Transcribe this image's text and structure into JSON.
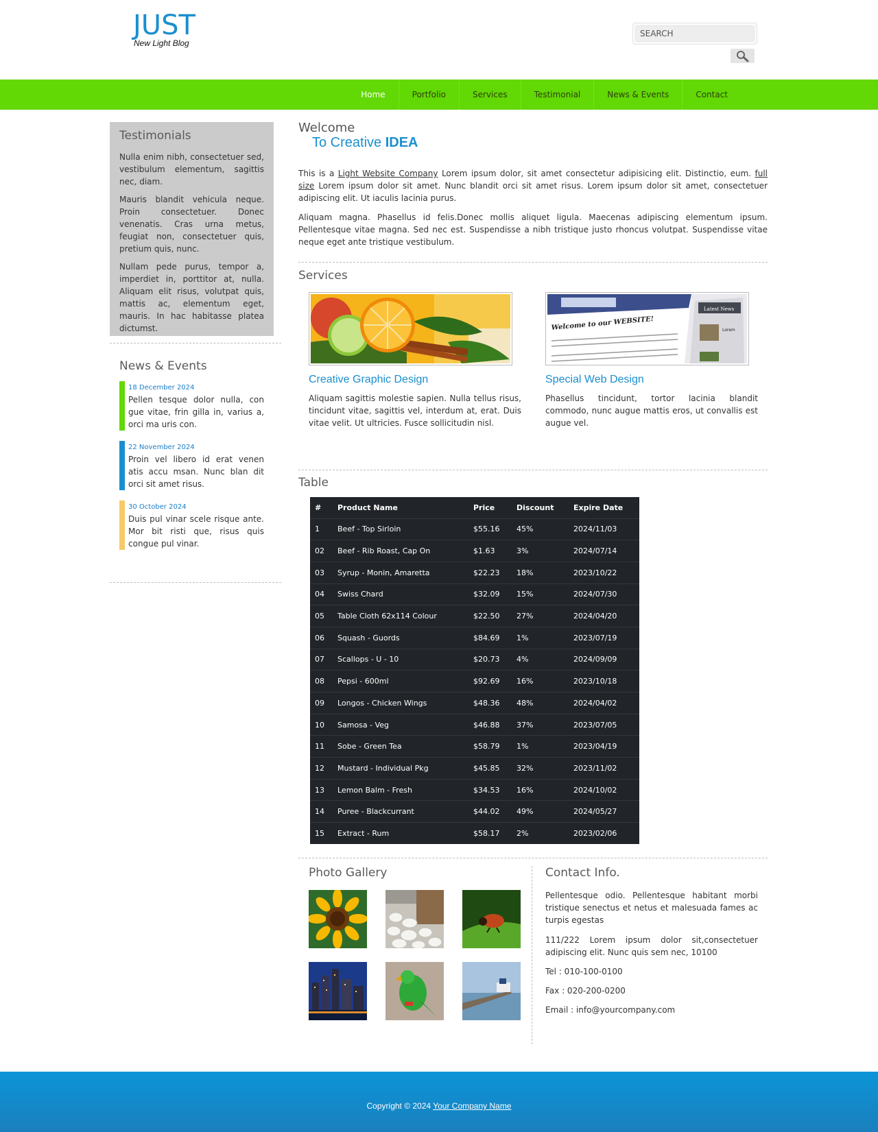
{
  "header": {
    "logo_title": "JUST",
    "logo_tagline": "New Light Blog",
    "search_placeholder": "SEARCH"
  },
  "nav": {
    "items": [
      "Home",
      "Portfolio",
      "Services",
      "Testimonial",
      "News & Events",
      "Contact"
    ],
    "active": "Home",
    "color": "#62d804"
  },
  "sidebar": {
    "testimonials": {
      "heading": "Testimonials",
      "paragraphs": [
        "Nulla enim nibh, consectetuer sed, vestibulum elementum, sagittis nec, diam.",
        "Mauris blandit vehicula neque. Proin consectetuer. Donec venenatis. Cras urna metus, feugiat non, consectetuer quis, pretium quis, nunc.",
        "Nullam pede purus, tempor a, imperdiet in, porttitor at, nulla. Aliquam elit risus, volutpat quis, mattis ac, elementum eget, mauris. In hac habitasse platea dictumst."
      ]
    },
    "news": {
      "heading": "News & Events",
      "items": [
        {
          "date": "18 December 2024",
          "text": "Pellen tesque dolor nulla, con gue vitae, frin gilla in, varius a, orci ma uris con.",
          "color": "#62d804"
        },
        {
          "date": "22 November 2024",
          "text": "Proin vel libero id erat venen atis accu msan. Nunc blan dit orci sit amet risus.",
          "color": "#1a8fcf"
        },
        {
          "date": "30 October 2024",
          "text": "Duis pul vinar scele risque ante. Mor bit risti que, risus quis congue pul vinar.",
          "color": "#f8c86a"
        }
      ]
    }
  },
  "welcome": {
    "title": "Welcome",
    "subtitle_prefix": "To Creative",
    "subtitle_bold": "IDEA",
    "para1_a": "This is a",
    "para1_link1": "Light Website Company",
    "para1_b": "Lorem ipsum dolor, sit amet consectetur adipisicing elit. Distinctio, eum.",
    "para1_link2": "full size",
    "para1_c": "Lorem ipsum dolor sit amet. Nunc blandit orci sit amet risus. Lorem ipsum dolor sit amet, consectetuer adipiscing elit. Ut iaculis lacinia purus.",
    "para2": "Aliquam magna. Phasellus id felis.Donec mollis aliquet ligula. Maecenas adipiscing elementum ipsum. Pellentesque vitae magna. Sed nec est. Suspendisse a nibh tristique justo rhoncus volutpat. Suspendisse vitae neque eget ante tristique vestibulum."
  },
  "services": {
    "heading": "Services",
    "items": [
      {
        "title": "Creative Graphic Design",
        "text": "Aliquam sagittis molestie sapien. Nulla tellus risus, tincidunt vitae, sagittis vel, interdum at, erat. Duis vitae velit. Ut ultricies. Fusce sollicitudin nisl."
      },
      {
        "title": "Special Web Design",
        "text": "Phasellus tincidunt, tortor lacinia blandit commodo, nunc augue mattis eros, ut convallis est augue vel."
      }
    ],
    "web_image": {
      "welcome_text": "Welcome to our WEBSITE!",
      "latest_news": "Latest News",
      "lorem": "Lorem"
    }
  },
  "table": {
    "heading": "Table",
    "columns": [
      "#",
      "Product Name",
      "Price",
      "Discount",
      "Expire Date"
    ],
    "rows": [
      [
        "1",
        "Beef - Top Sirloin",
        "$55.16",
        "45%",
        "2024/11/03"
      ],
      [
        "02",
        "Beef - Rib Roast, Cap On",
        "$1.63",
        "3%",
        "2024/07/14"
      ],
      [
        "03",
        "Syrup - Monin, Amaretta",
        "$22.23",
        "18%",
        "2023/10/22"
      ],
      [
        "04",
        "Swiss Chard",
        "$32.09",
        "15%",
        "2024/07/30"
      ],
      [
        "05",
        "Table Cloth 62x114 Colour",
        "$22.50",
        "27%",
        "2024/04/20"
      ],
      [
        "06",
        "Squash - Guords",
        "$84.69",
        "1%",
        "2023/07/19"
      ],
      [
        "07",
        "Scallops - U - 10",
        "$20.73",
        "4%",
        "2024/09/09"
      ],
      [
        "08",
        "Pepsi - 600ml",
        "$92.69",
        "16%",
        "2023/10/18"
      ],
      [
        "09",
        "Longos - Chicken Wings",
        "$48.36",
        "48%",
        "2024/04/02"
      ],
      [
        "10",
        "Samosa - Veg",
        "$46.88",
        "37%",
        "2023/07/05"
      ],
      [
        "11",
        "Sobe - Green Tea",
        "$58.79",
        "1%",
        "2023/04/19"
      ],
      [
        "12",
        "Mustard - Individual Pkg",
        "$45.85",
        "32%",
        "2023/11/02"
      ],
      [
        "13",
        "Lemon Balm - Fresh",
        "$34.53",
        "16%",
        "2024/10/02"
      ],
      [
        "14",
        "Puree - Blackcurrant",
        "$44.02",
        "49%",
        "2024/05/27"
      ],
      [
        "15",
        "Extract - Rum",
        "$58.17",
        "2%",
        "2023/02/06"
      ]
    ]
  },
  "gallery": {
    "heading": "Photo Gallery",
    "photos": [
      "sunflower",
      "white-pebbles",
      "red-beetle-on-leaf",
      "city-skyline-night",
      "green-parrot",
      "pier-with-boat"
    ]
  },
  "contact": {
    "heading": "Contact Info.",
    "para1": "Pellentesque odio. Pellentesque habitant morbi tristique senectus et netus et malesuada fames ac turpis egestas",
    "para2": "111/222 Lorem ipsum dolor sit,consectetuer adipiscing elit. Nunc quis sem nec, 10100",
    "tel": "Tel : 010-100-0100",
    "fax": "Fax : 020-200-0200",
    "email": "Email : info@yourcompany.com"
  },
  "footer": {
    "copyright": "Copyright © 2024",
    "company_link": "Your Company Name"
  }
}
